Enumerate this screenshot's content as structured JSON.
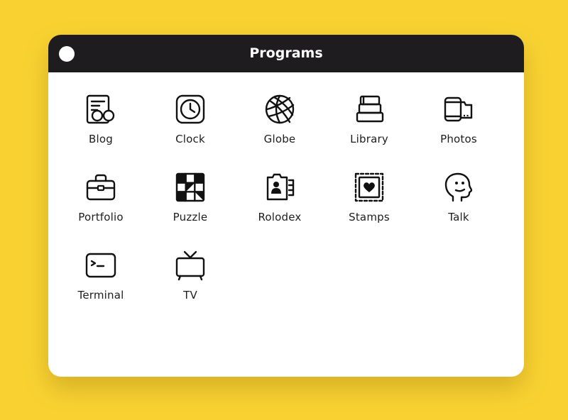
{
  "window": {
    "title": "Programs",
    "close_button": "close"
  },
  "apps": [
    {
      "label": "Blog",
      "icon": "blog-icon"
    },
    {
      "label": "Clock",
      "icon": "clock-icon"
    },
    {
      "label": "Globe",
      "icon": "globe-icon"
    },
    {
      "label": "Library",
      "icon": "library-icon"
    },
    {
      "label": "Photos",
      "icon": "photos-icon"
    },
    {
      "label": "Portfolio",
      "icon": "portfolio-icon"
    },
    {
      "label": "Puzzle",
      "icon": "puzzle-icon"
    },
    {
      "label": "Rolodex",
      "icon": "rolodex-icon"
    },
    {
      "label": "Stamps",
      "icon": "stamps-icon"
    },
    {
      "label": "Talk",
      "icon": "talk-icon"
    },
    {
      "label": "Terminal",
      "icon": "terminal-icon"
    },
    {
      "label": "TV",
      "icon": "tv-icon"
    }
  ],
  "colors": {
    "background": "#f9d232",
    "titlebar": "#1e1c1e",
    "window": "#ffffff",
    "text": "#1e1c1e"
  }
}
